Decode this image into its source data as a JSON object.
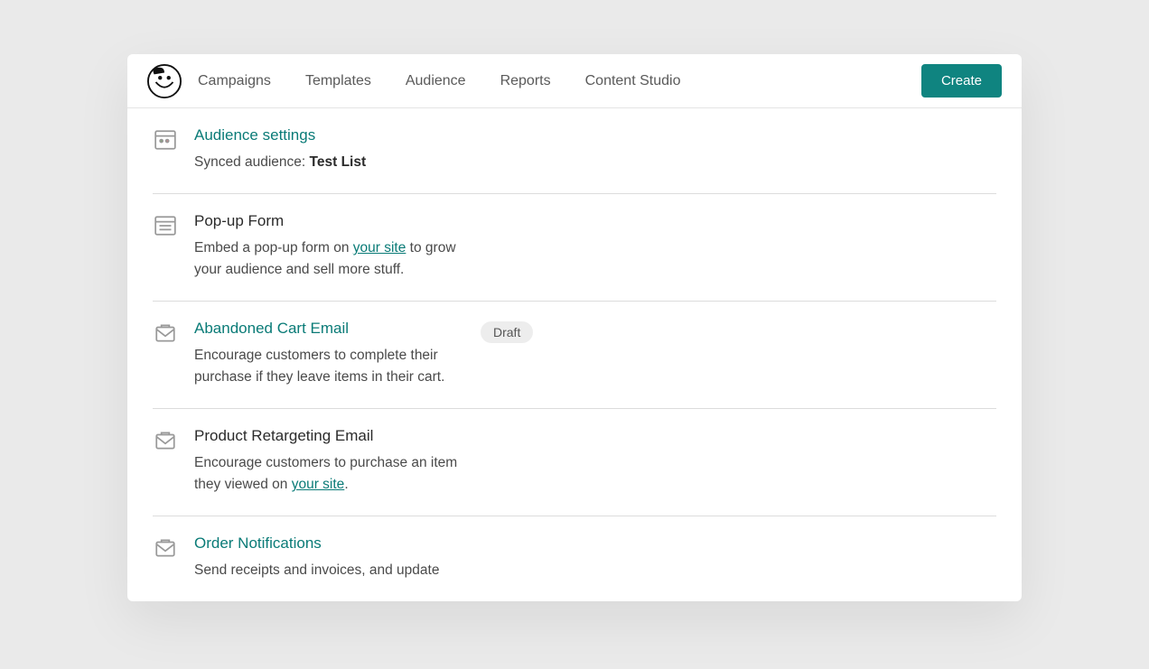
{
  "nav": {
    "items": [
      "Campaigns",
      "Templates",
      "Audience",
      "Reports",
      "Content Studio"
    ]
  },
  "create_label": "Create",
  "rows": [
    {
      "title": "Audience settings",
      "title_link": true,
      "desc_prefix": "Synced audience: ",
      "desc_bold": "Test List",
      "desc_suffix": ""
    },
    {
      "title": "Pop-up Form",
      "title_link": false,
      "desc_line1_a": "Embed a pop-up form on ",
      "desc_link": "your site",
      "desc_line1_b": " to grow your audience and sell more stuff."
    },
    {
      "title": "Abandoned Cart Email",
      "title_link": true,
      "badge": "Draft",
      "desc_plain": "Encourage customers to complete their purchase if they leave items in their cart."
    },
    {
      "title": "Product Retargeting Email",
      "title_link": false,
      "desc_line1_a": "Encourage customers to purchase an item they viewed on ",
      "desc_link": "your site",
      "desc_line1_b": "."
    },
    {
      "title": "Order Notifications",
      "title_link": true,
      "desc_plain": "Send receipts and invoices, and update"
    }
  ]
}
